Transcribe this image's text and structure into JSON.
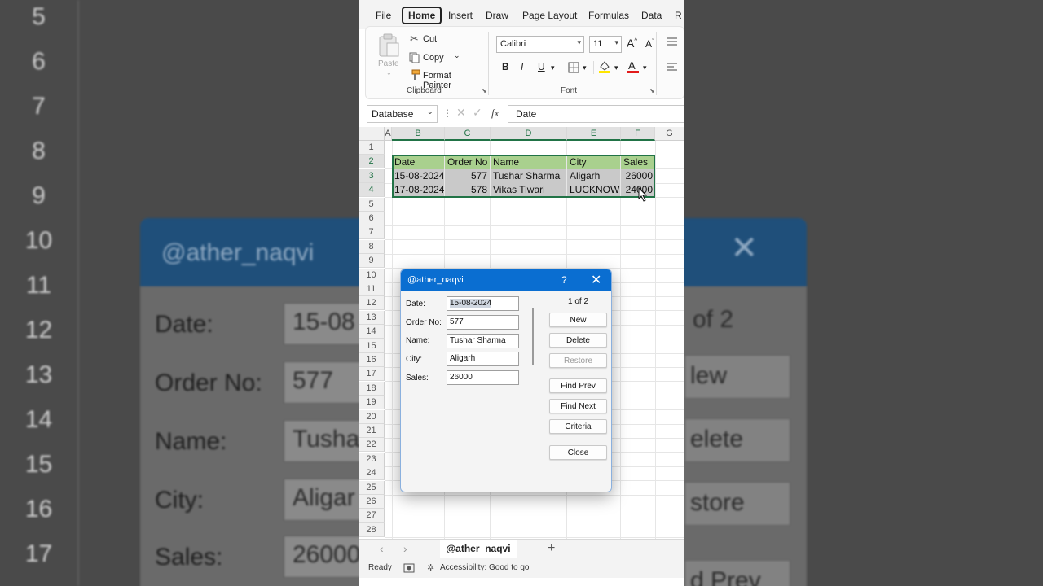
{
  "background": {
    "row_numbers": [
      "5",
      "6",
      "7",
      "8",
      "9",
      "10",
      "11",
      "12",
      "13",
      "14",
      "15",
      "16",
      "17"
    ],
    "left_dialog": {
      "title": "@ather_naqvi",
      "labels": [
        "Date:",
        "Order No:",
        "Name:",
        "City:",
        "Sales:"
      ],
      "values": [
        "15-08",
        "577",
        "Tusha",
        "Aligar",
        "26000"
      ]
    },
    "right_dialog": {
      "close": "✕",
      "count_fragment": "of 2",
      "buttons": [
        "lew",
        "elete",
        "store",
        "d Prev"
      ]
    }
  },
  "menu": [
    "File",
    "Home",
    "Insert",
    "Draw",
    "Page Layout",
    "Formulas",
    "Data",
    "R"
  ],
  "ribbon": {
    "clipboard": {
      "paste": "Paste",
      "cut": "Cut",
      "copy": "Copy",
      "format_painter": "Format Painter",
      "group_label": "Clipboard"
    },
    "font": {
      "name": "Calibri",
      "size": "11",
      "grow": "A",
      "shrink": "A",
      "bold": "B",
      "italic": "I",
      "underline": "U",
      "group_label": "Font",
      "fill_color": "#ffe600",
      "text_color": "#e21b1b"
    }
  },
  "formula_bar": {
    "name_box": "Database",
    "fx": "fx",
    "value": "Date"
  },
  "grid": {
    "columns": [
      "A",
      "B",
      "C",
      "D",
      "E",
      "F",
      "G"
    ],
    "rows": [
      "1",
      "2",
      "3",
      "4",
      "5",
      "6",
      "7",
      "8",
      "9",
      "10",
      "11",
      "12",
      "13",
      "14",
      "15",
      "16",
      "17",
      "18",
      "19",
      "20",
      "21",
      "22",
      "23",
      "24",
      "25",
      "26",
      "27",
      "28"
    ],
    "table": {
      "headers": [
        "Date",
        "Order No",
        "Name",
        "City",
        "Sales"
      ],
      "rows": [
        [
          "15-08-2024",
          "577",
          "Tushar Sharma",
          "Aligarh",
          "26000"
        ],
        [
          "17-08-2024",
          "578",
          "Vikas Tiwari",
          "LUCKNOW",
          "24000"
        ]
      ]
    }
  },
  "sheet": {
    "prev": "‹",
    "next": "›",
    "tab": "@ather_naqvi",
    "add": "+"
  },
  "status": {
    "ready": "Ready",
    "accessibility": "Accessibility: Good to go"
  },
  "dialog": {
    "title": "@ather_naqvi",
    "help": "?",
    "close": "✕",
    "fields": [
      {
        "label": "Date:",
        "value": "15-08-2024"
      },
      {
        "label": "Order No:",
        "value": "577"
      },
      {
        "label": "Name:",
        "value": "Tushar Sharma"
      },
      {
        "label": "City:",
        "value": "Aligarh"
      },
      {
        "label": "Sales:",
        "value": "26000"
      }
    ],
    "record_count": "1 of 2",
    "buttons": [
      "New",
      "Delete",
      "Restore",
      "Find Prev",
      "Find Next",
      "Criteria",
      "Close"
    ]
  }
}
